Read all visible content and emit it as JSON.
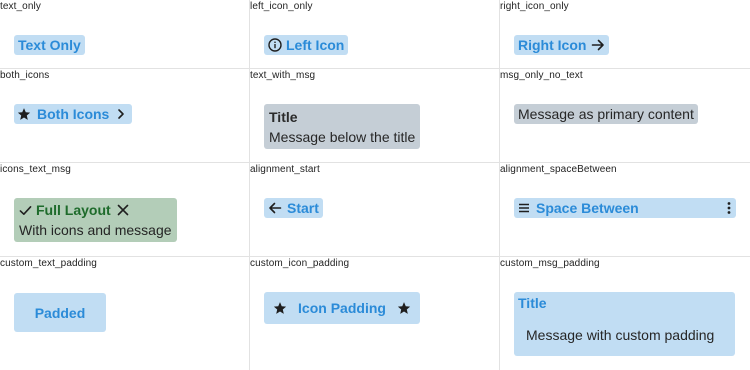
{
  "cells": {
    "text_only": {
      "caption": "text_only",
      "label": "Text Only"
    },
    "left_icon_only": {
      "caption": "left_icon_only",
      "label": "Left Icon"
    },
    "right_icon_only": {
      "caption": "right_icon_only",
      "label": "Right Icon"
    },
    "both_icons": {
      "caption": "both_icons",
      "label": "Both Icons"
    },
    "text_with_msg": {
      "caption": "text_with_msg",
      "label": "Title",
      "message": "Message below the title"
    },
    "msg_only_no_text": {
      "caption": "msg_only_no_text",
      "message": "Message as primary content"
    },
    "icons_text_msg": {
      "caption": "icons_text_msg",
      "label": "Full Layout",
      "message": "With icons and message"
    },
    "alignment_start": {
      "caption": "alignment_start",
      "label": "Start"
    },
    "alignment_spaceBetween": {
      "caption": "alignment_spaceBetween",
      "label": "Space Between"
    },
    "custom_text_padding": {
      "caption": "custom_text_padding",
      "label": "Padded"
    },
    "custom_icon_padding": {
      "caption": "custom_icon_padding",
      "label": "Icon Padding"
    },
    "custom_msg_padding": {
      "caption": "custom_msg_padding",
      "label": "Title",
      "message": "Message with custom padding"
    }
  },
  "icons": {
    "left_icon_only": "info-icon",
    "right_icon_only": "arrow-right-icon",
    "both_icons_left": "star-icon",
    "both_icons_right": "chevron-right-icon",
    "icons_text_msg_left": "check-icon",
    "icons_text_msg_right": "close-icon",
    "alignment_start": "arrow-left-icon",
    "alignment_spaceBetween_left": "menu-icon",
    "alignment_spaceBetween_right": "more-vertical-icon",
    "custom_icon_padding_left": "star-icon",
    "custom_icon_padding_right": "star-icon"
  },
  "colors": {
    "blue_bg": "#c1ddf3",
    "blue_text": "#2b8bd8",
    "gray_bg": "#c5ced6",
    "green_bg": "#b3cdb8",
    "green_text": "#1e6b2b",
    "grid_line": "#e2e2e2"
  }
}
